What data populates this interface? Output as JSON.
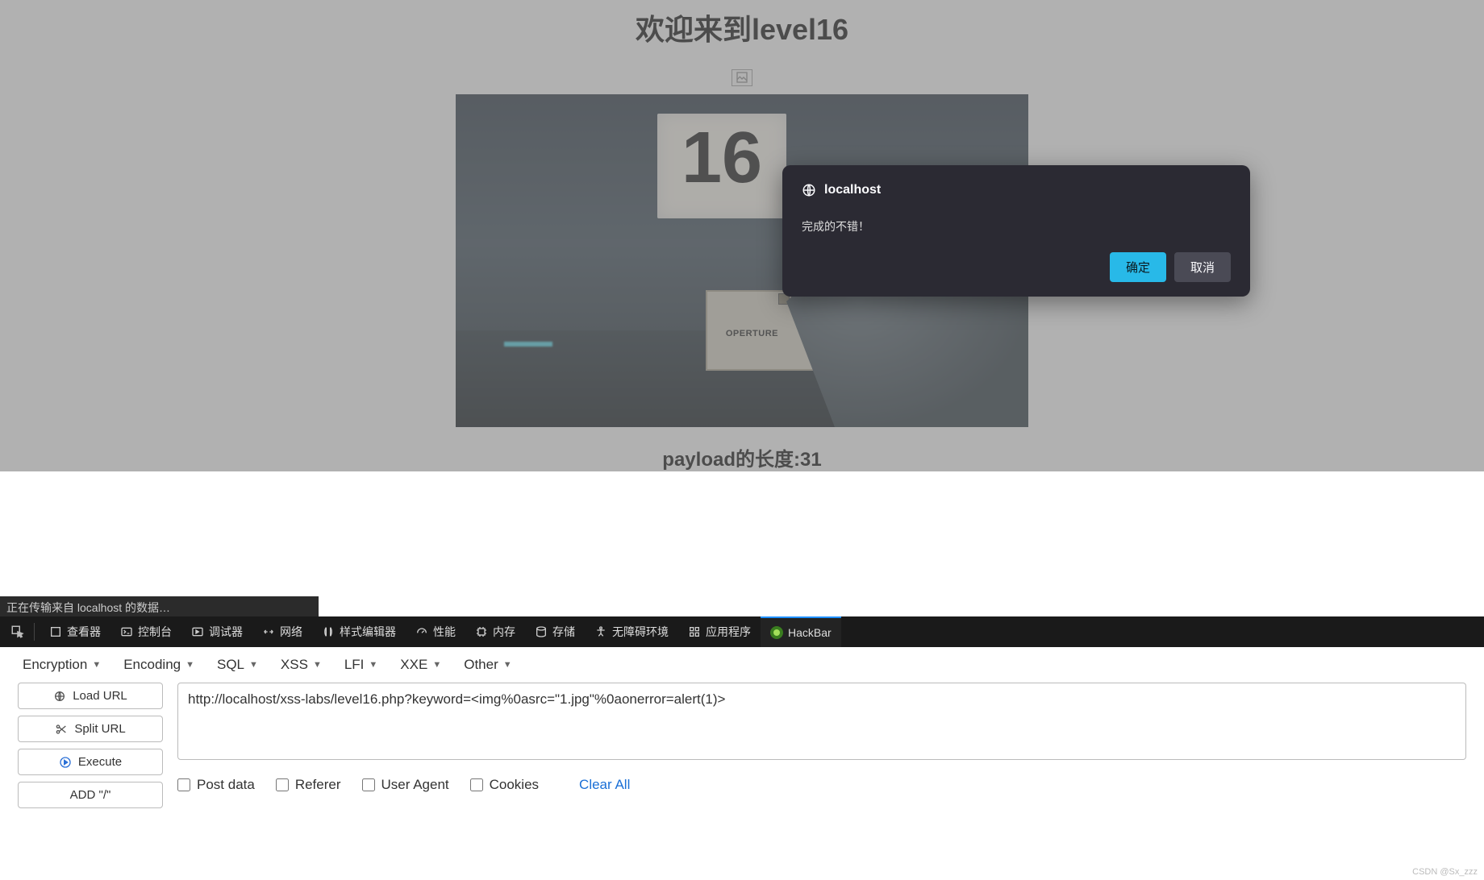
{
  "page": {
    "title": "欢迎来到level16",
    "sign_number": "16",
    "aperture_label": "OPERTURE",
    "payload_text": "payload的长度:31"
  },
  "dialog": {
    "host": "localhost",
    "message": "完成的不错！",
    "ok": "确定",
    "cancel": "取消"
  },
  "status_bar": "正在传输来自 localhost 的数据…",
  "devtools": {
    "tabs": [
      {
        "id": "inspector",
        "label": "查看器"
      },
      {
        "id": "console",
        "label": "控制台"
      },
      {
        "id": "debugger",
        "label": "调试器"
      },
      {
        "id": "network",
        "label": "网络"
      },
      {
        "id": "style",
        "label": "样式编辑器"
      },
      {
        "id": "perf",
        "label": "性能"
      },
      {
        "id": "memory",
        "label": "内存"
      },
      {
        "id": "storage",
        "label": "存储"
      },
      {
        "id": "a11y",
        "label": "无障碍环境"
      },
      {
        "id": "app",
        "label": "应用程序"
      },
      {
        "id": "hackbar",
        "label": "HackBar",
        "active": true
      }
    ]
  },
  "hackbar": {
    "menu": [
      "Encryption",
      "Encoding",
      "SQL",
      "XSS",
      "LFI",
      "XXE",
      "Other"
    ],
    "buttons": {
      "load": "Load URL",
      "split": "Split URL",
      "execute": "Execute",
      "add_slash": "ADD \"/\""
    },
    "url": "http://localhost/xss-labs/level16.php?keyword=<img%0asrc=\"1.jpg\"%0aonerror=alert(1)>",
    "checks": {
      "post": "Post data",
      "referer": "Referer",
      "ua": "User Agent",
      "cookies": "Cookies"
    },
    "clear_all": "Clear All"
  },
  "watermark": "CSDN @Sx_zzz"
}
